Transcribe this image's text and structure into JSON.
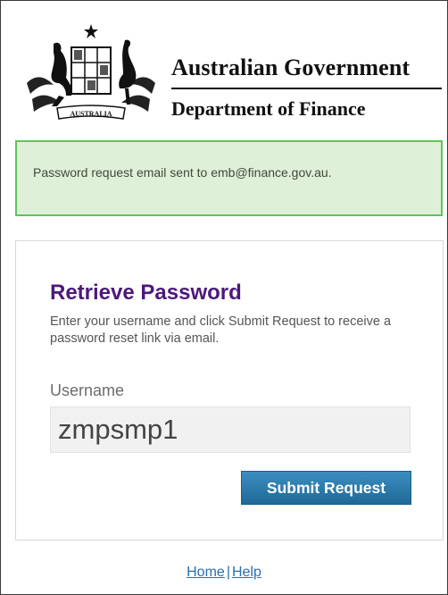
{
  "header": {
    "gov_name": "Australian Government",
    "dept_name": "Department of Finance",
    "crest_text": "AUSTRALIA"
  },
  "alert": {
    "message": "Password request email sent to emb@finance.gov.au.",
    "color": "#dff0d8",
    "border_color": "#5cc65c"
  },
  "form": {
    "title": "Retrieve Password",
    "description": "Enter your username and click Submit Request to receive a password reset link via email.",
    "username_label": "Username",
    "username_value": "zmpsmp1",
    "submit_label": "Submit Request"
  },
  "footer": {
    "home_label": "Home",
    "separator": "|",
    "help_label": "Help"
  },
  "colors": {
    "title_purple": "#4b1a7a",
    "button_blue": "#2a78a8",
    "link_blue": "#2a6fb0"
  }
}
